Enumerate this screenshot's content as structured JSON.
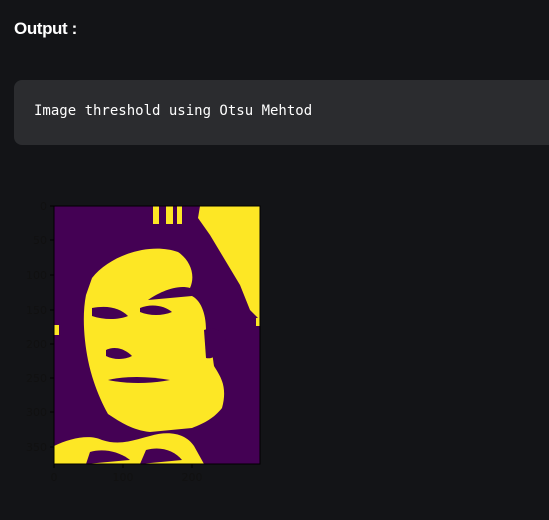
{
  "output": {
    "heading": "Output :"
  },
  "code_block": {
    "text": "Image threshold using Otsu Mehtod"
  },
  "plot": {
    "yticks": [
      "0",
      "50",
      "100",
      "150",
      "200",
      "250",
      "300",
      "350"
    ],
    "xticks": [
      "0",
      "100",
      "200"
    ],
    "colors": {
      "background_class": "#440154",
      "foreground_class": "#fde725",
      "axis": "#000000",
      "tick_label": "#111111"
    }
  }
}
